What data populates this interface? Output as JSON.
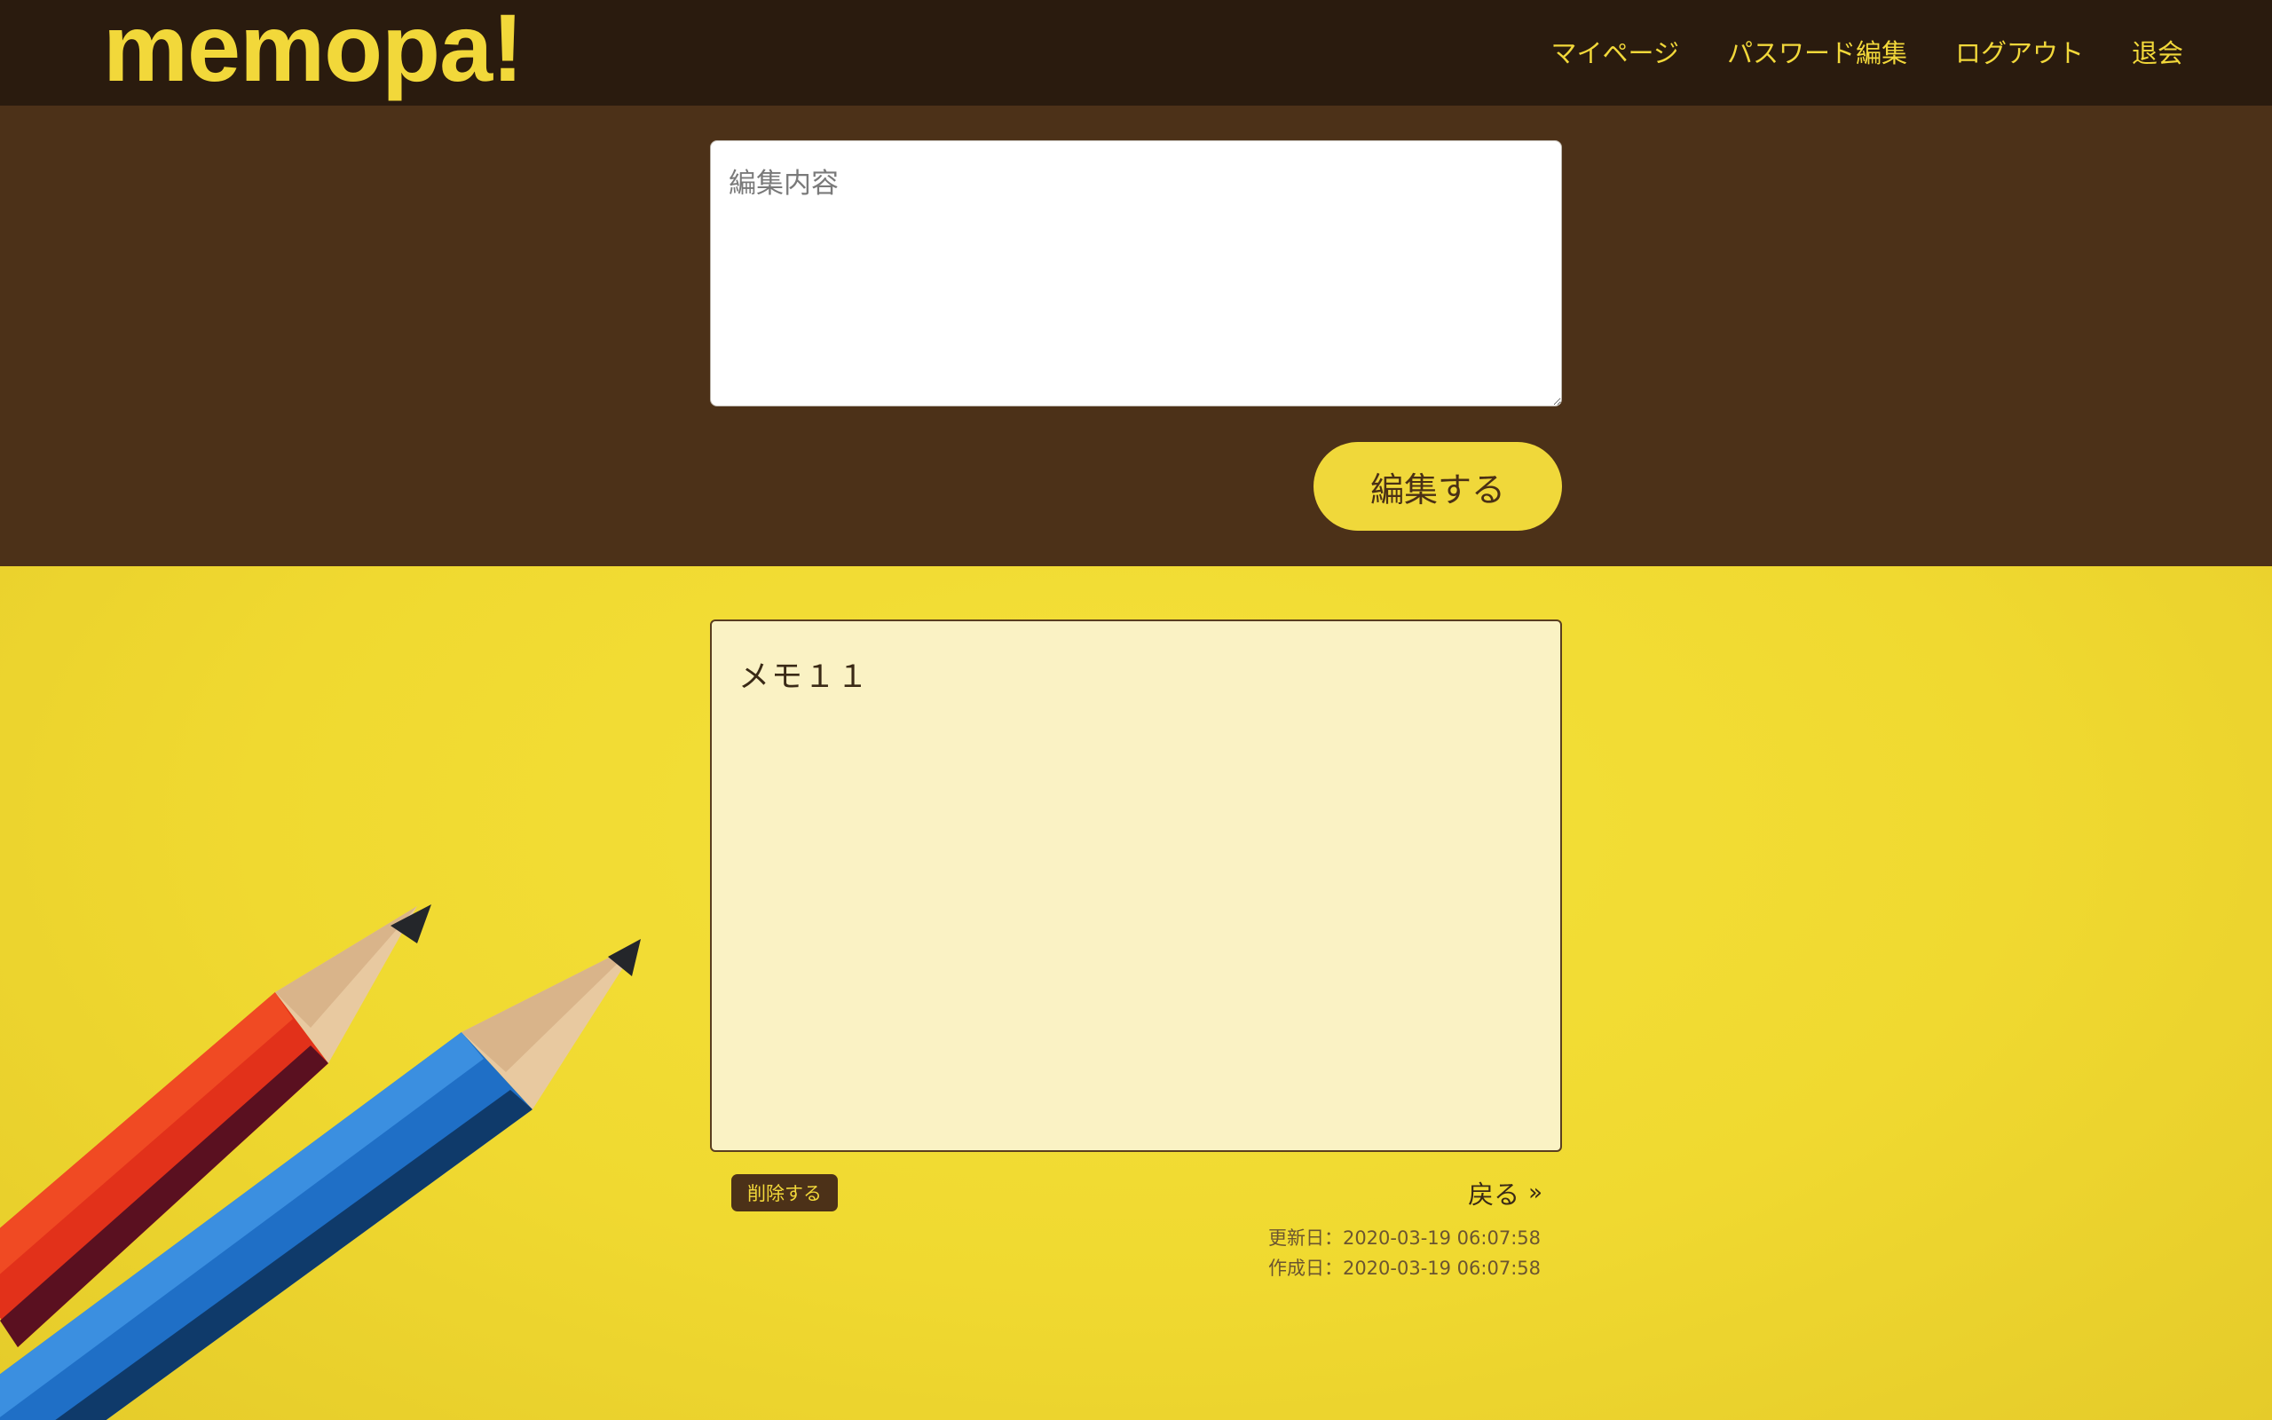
{
  "header": {
    "logo": "memopa!",
    "nav": [
      {
        "label": "マイページ"
      },
      {
        "label": "パスワード編集"
      },
      {
        "label": "ログアウト"
      },
      {
        "label": "退会"
      }
    ]
  },
  "edit": {
    "placeholder": "編集内容",
    "value": "",
    "submit_label": "編集する"
  },
  "memo": {
    "content": "メモ１１"
  },
  "actions": {
    "delete_label": "削除する",
    "back_label": "戻る",
    "back_chevron": "»"
  },
  "dates": {
    "updated": "更新日：2020-03-19 06:07:58",
    "created": "作成日：2020-03-19 06:07:58"
  },
  "colors": {
    "header_bg": "#2a1b0e",
    "edit_bg": "#4c3118",
    "accent_yellow": "#f2d83a",
    "memo_bg": "#faf2c4"
  }
}
